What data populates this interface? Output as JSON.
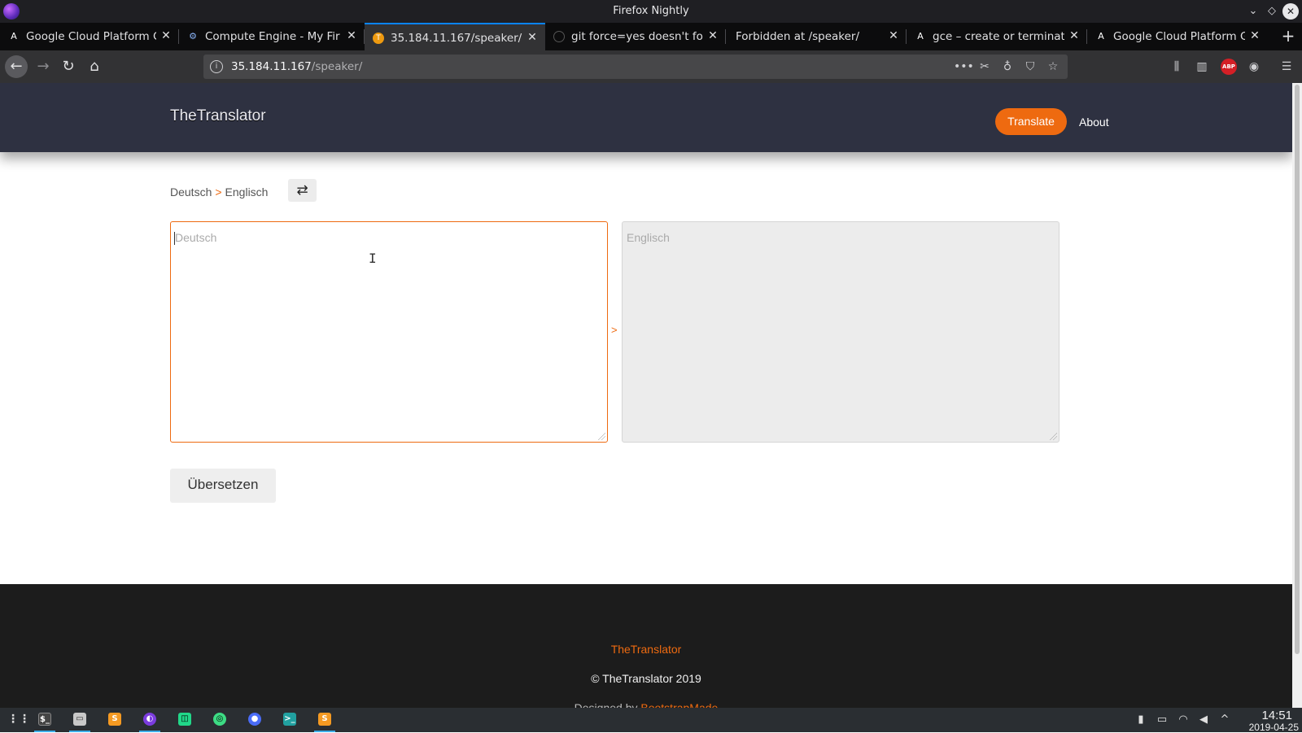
{
  "window": {
    "title": "Firefox Nightly"
  },
  "tabs": [
    {
      "label": "Google Cloud Platform G",
      "icon": "A",
      "active": false
    },
    {
      "label": "Compute Engine - My Fir",
      "icon": "⚙",
      "active": false
    },
    {
      "label": "35.184.11.167/speaker/",
      "icon": "T",
      "active": true
    },
    {
      "label": "git force=yes doesn't for",
      "icon": "",
      "active": false
    },
    {
      "label": "Forbidden at /speaker/",
      "icon": "",
      "active": false
    },
    {
      "label": "gce – create or terminate",
      "icon": "A",
      "active": false
    },
    {
      "label": "Google Cloud Platform G",
      "icon": "A",
      "active": false
    }
  ],
  "navbar": {
    "url_host": "35.184.11.167",
    "url_path": "/speaker/"
  },
  "site": {
    "brand": "TheTranslator",
    "nav": {
      "translate": "Translate",
      "about": "About"
    },
    "lang": {
      "source": "Deutsch",
      "arrow": ">",
      "target": "Englisch"
    },
    "source_placeholder": "Deutsch",
    "target_placeholder": "Englisch",
    "middle_arrow": ">",
    "translate_button": "Übersetzen",
    "footer": {
      "brand": "TheTranslator",
      "copyright": "© TheTranslator 2019",
      "designed_prefix": "Designed by",
      "designed_name": "BootstrapMade"
    }
  },
  "taskbar": {
    "clock_time": "14:51",
    "clock_date": "2019-04-25"
  },
  "colors": {
    "accent": "#ee6a10",
    "header_bg": "#2e3141",
    "footer_bg": "#1c1c1c",
    "tab_active_border": "#0a84ff"
  }
}
